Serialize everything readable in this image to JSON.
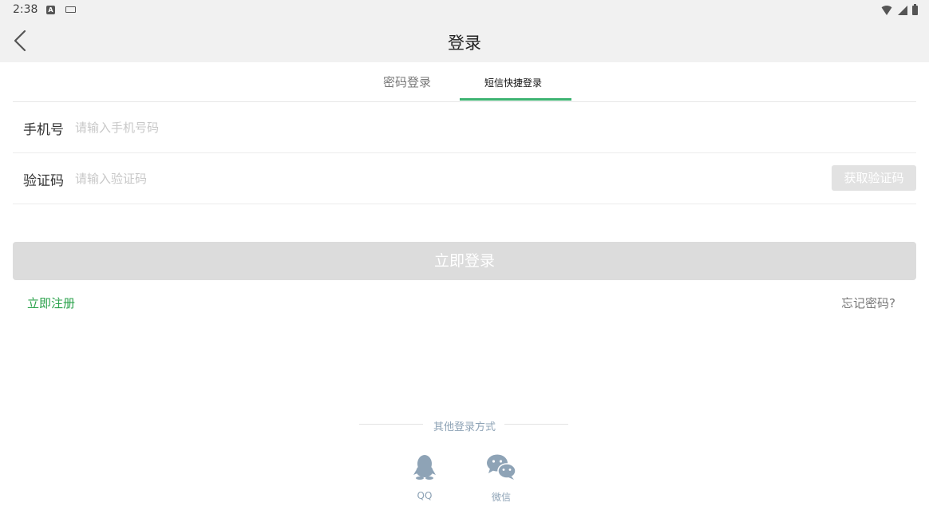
{
  "status_bar": {
    "time": "2:38",
    "icons": [
      "a-icon",
      "keyboard-icon",
      "wifi-icon",
      "signal-icon",
      "battery-icon"
    ]
  },
  "header": {
    "title": "登录",
    "back_icon": "chevron-left-icon"
  },
  "tabs": [
    {
      "label": "密码登录",
      "active": false
    },
    {
      "label": "短信快捷登录",
      "active": true
    }
  ],
  "form": {
    "phone": {
      "label": "手机号",
      "placeholder": "请输入手机号码",
      "value": ""
    },
    "code": {
      "label": "验证码",
      "placeholder": "请输入验证码",
      "value": ""
    },
    "get_code_label": "获取验证码"
  },
  "login_button": "立即登录",
  "links": {
    "register": "立即注册",
    "forgot": "忘记密码?"
  },
  "other_login": {
    "title": "其他登录方式",
    "options": [
      {
        "label": "QQ",
        "icon": "qq-icon"
      },
      {
        "label": "微信",
        "icon": "wechat-icon"
      }
    ]
  },
  "colors": {
    "accent": "#3cb371",
    "link_green": "#2aa24b",
    "social_icon": "#8ea3b6",
    "disabled_button": "#dcdcdc",
    "header_bg": "#f1f1f1"
  }
}
